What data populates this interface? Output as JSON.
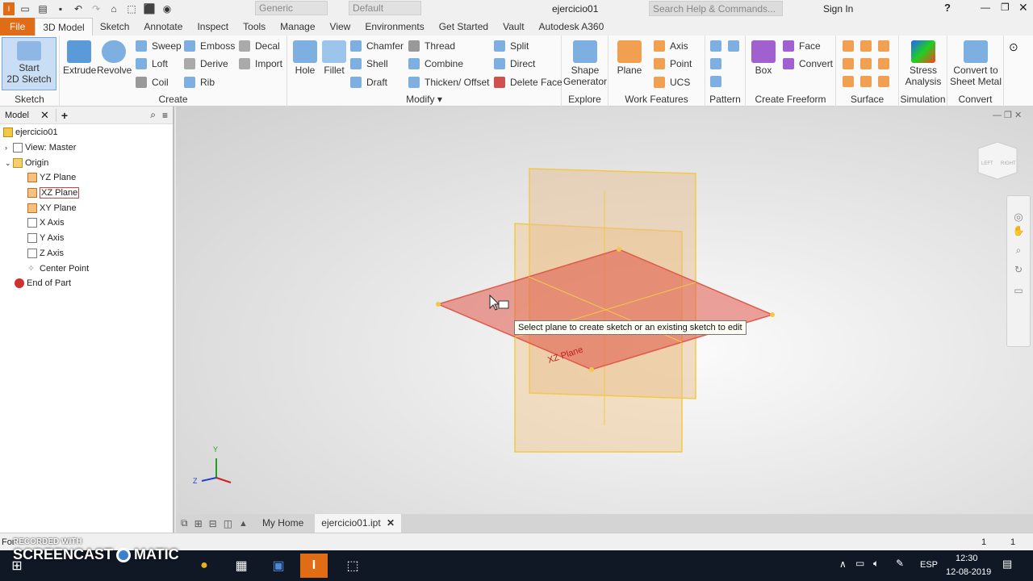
{
  "qat": {
    "style_value": "Generic",
    "appearance_value": "Default",
    "doc_title": "ejercicio01",
    "search_placeholder": "Search Help & Commands...",
    "sign_in": "Sign In",
    "help": "?"
  },
  "menu": {
    "tabs": [
      "File",
      "3D Model",
      "Sketch",
      "Annotate",
      "Inspect",
      "Tools",
      "Manage",
      "View",
      "Environments",
      "Get Started",
      "Vault",
      "Autodesk A360"
    ]
  },
  "ribbon": {
    "sketch": {
      "start_line1": "Start",
      "start_line2": "2D Sketch",
      "group": "Sketch"
    },
    "create": {
      "extrude": "Extrude",
      "revolve": "Revolve",
      "sweep": "Sweep",
      "loft": "Loft",
      "coil": "Coil",
      "emboss": "Emboss",
      "derive": "Derive",
      "rib": "Rib",
      "decal": "Decal",
      "import": "Import",
      "group": "Create"
    },
    "modify": {
      "hole": "Hole",
      "fillet": "Fillet",
      "chamfer": "Chamfer",
      "shell": "Shell",
      "draft": "Draft",
      "thread": "Thread",
      "combine": "Combine",
      "thicken": "Thicken/ Offset",
      "split": "Split",
      "direct": "Direct",
      "delete_face": "Delete Face",
      "group": "Modify"
    },
    "explore": {
      "line1": "Shape",
      "line2": "Generator",
      "group": "Explore"
    },
    "work": {
      "plane": "Plane",
      "axis": "Axis",
      "point": "Point",
      "ucs": "UCS",
      "group": "Work Features"
    },
    "pattern": {
      "group": "Pattern"
    },
    "freeform": {
      "box": "Box",
      "face": "Face",
      "convert": "Convert",
      "group": "Create Freeform"
    },
    "surface": {
      "group": "Surface"
    },
    "simulation": {
      "line1": "Stress",
      "line2": "Analysis",
      "group": "Simulation"
    },
    "convert": {
      "line1": "Convert to",
      "line2": "Sheet Metal",
      "group": "Convert"
    }
  },
  "browser": {
    "tab": "Model",
    "add": "+",
    "items": [
      "ejercicio01",
      "View: Master",
      "Origin",
      "YZ Plane",
      "XZ Plane",
      "XY Plane",
      "X Axis",
      "Y Axis",
      "Z Axis",
      "Center Point",
      "End of Part"
    ]
  },
  "viewport": {
    "tooltip": "Select plane to create sketch or an existing sketch to edit",
    "plane_label": "XZ Plane",
    "viewcube_left": "LEFT",
    "viewcube_right": "RIGHT",
    "triad_y": "Y",
    "triad_z": "Z"
  },
  "doc_tabs": {
    "home": "My Home",
    "file": "ejercicio01.ipt"
  },
  "status": {
    "left": "For",
    "num1": "1",
    "num2": "1"
  },
  "watermark": {
    "line1": "RECORDED WITH",
    "line2": "SCREENCAST",
    "line3": "MATIC"
  },
  "taskbar": {
    "lang": "ESP",
    "time": "12:30",
    "date": "12-08-2019"
  },
  "colors": {
    "accent": "#e06c16",
    "plane_yellow": "#f2c84b",
    "plane_red": "#e05a4a"
  }
}
